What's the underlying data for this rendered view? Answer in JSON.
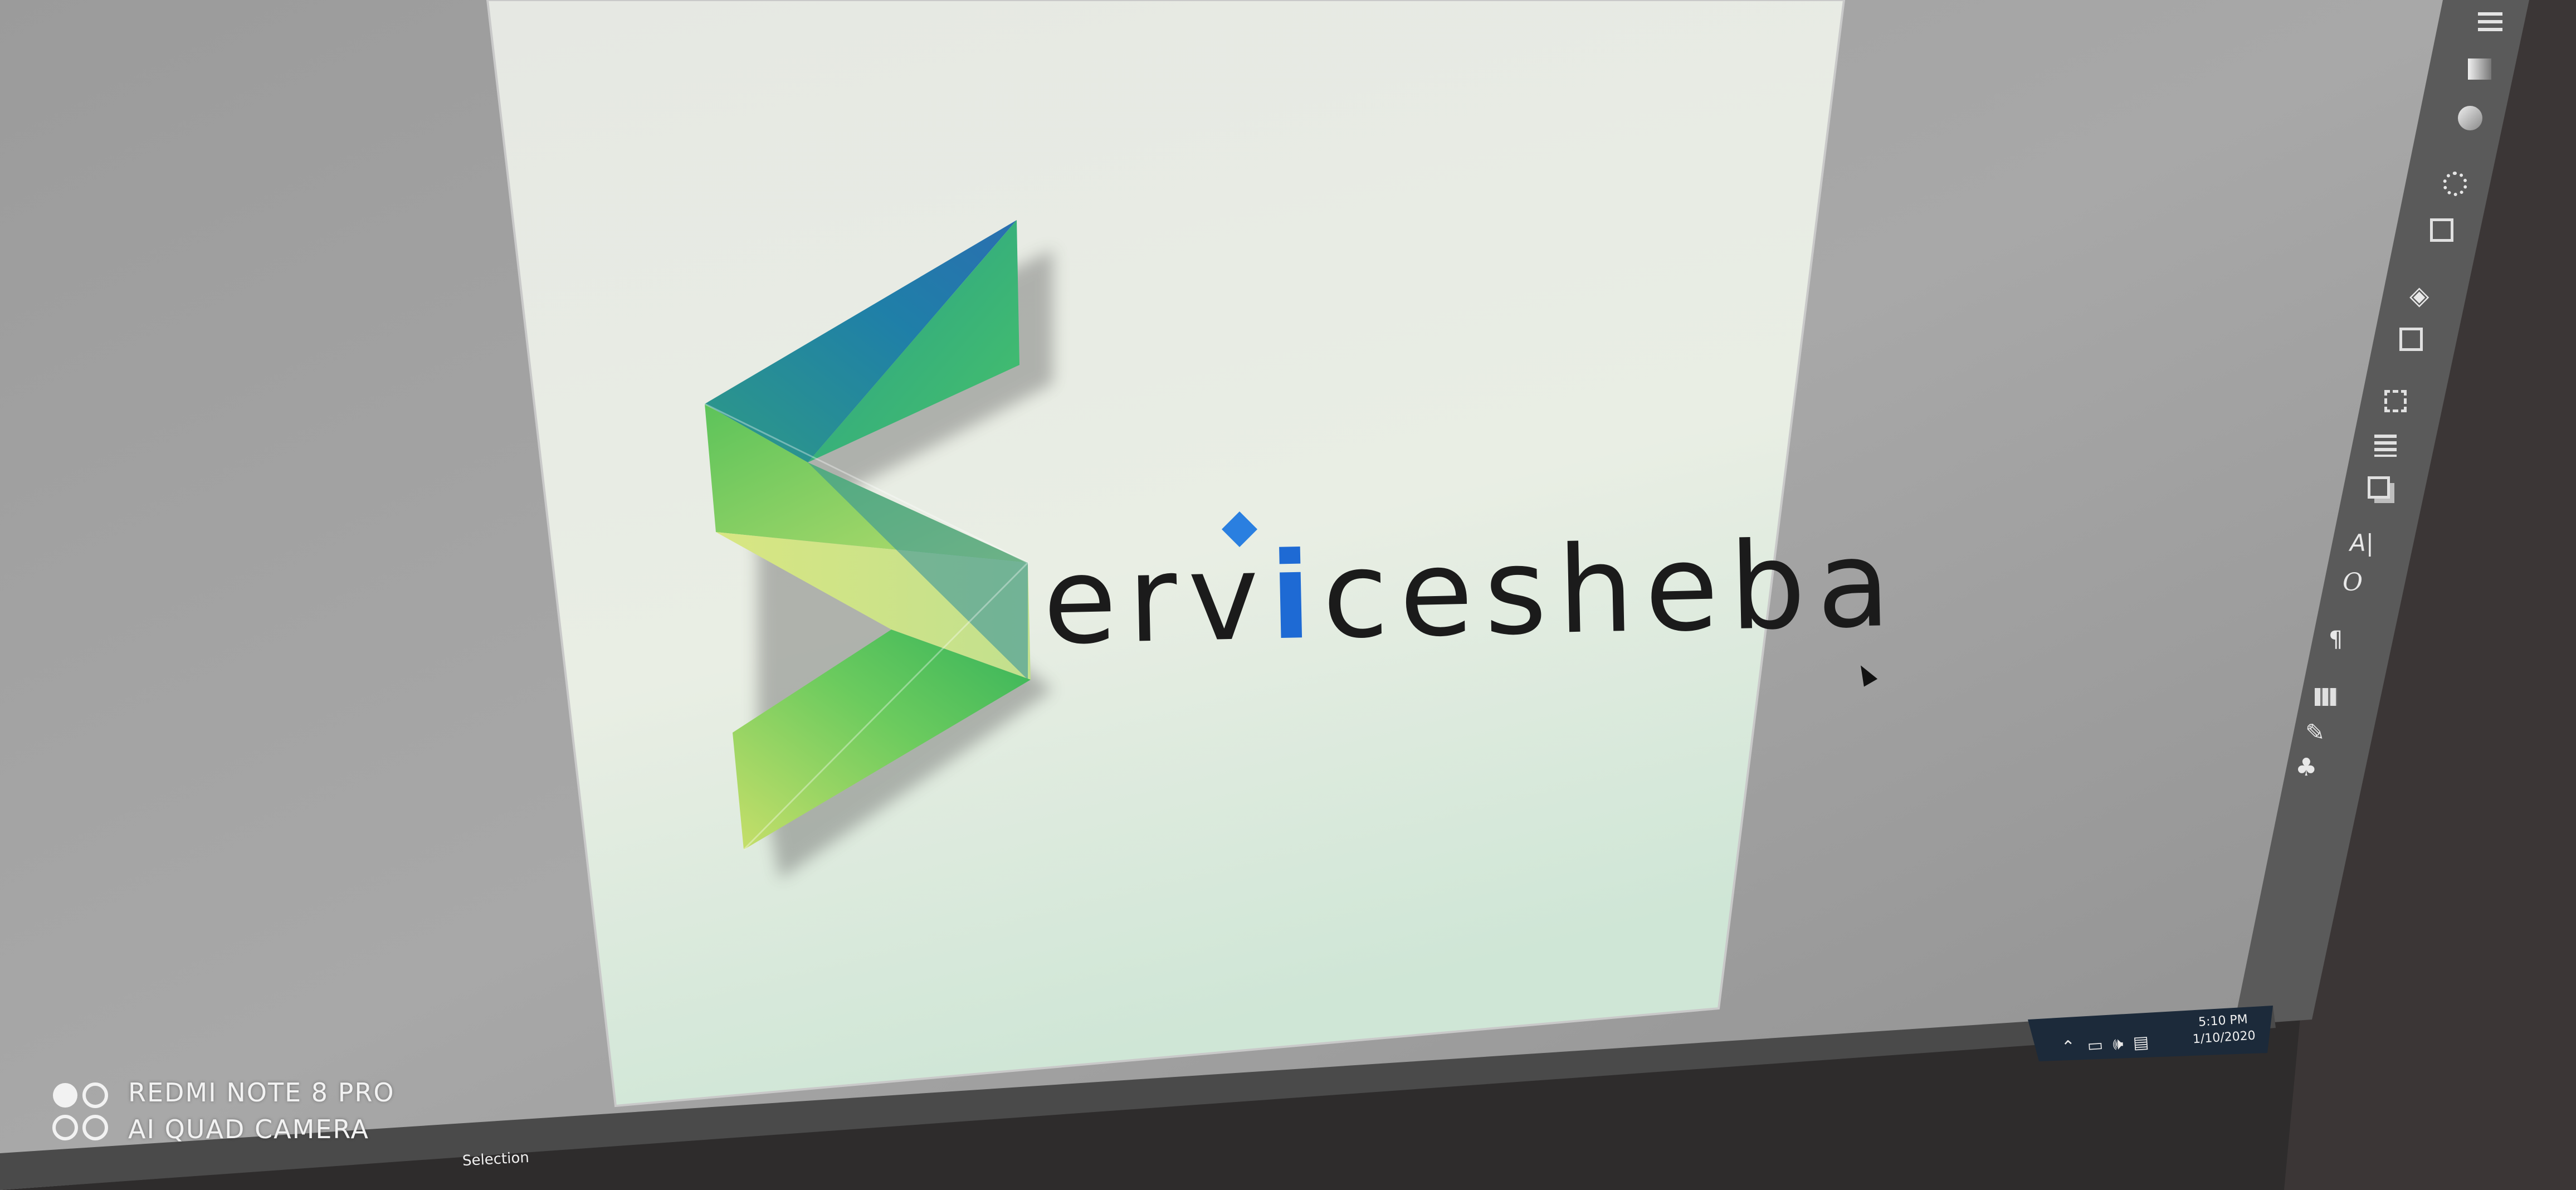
{
  "logo": {
    "wordmark_lead": "erv",
    "wordmark_i": "i",
    "wordmark_tail": "cesheba",
    "colors": {
      "teal": "#1f8a9e",
      "green": "#39b54a",
      "lime": "#c8e06a",
      "blue": "#1e73d8",
      "text": "#1b1b1b"
    }
  },
  "taskbar": {
    "time": "5:10 PM",
    "date": "1/10/2020"
  },
  "statusbar": {
    "tool_label": "Selection"
  },
  "watermark": {
    "line1": "REDMI NOTE 8 PRO",
    "line2": "AI QUAD CAMERA"
  },
  "panel_icons": [
    "menu-icon",
    "gradient-icon",
    "transparency-icon",
    "appearance-icon",
    "graphic-styles-icon",
    "layers-icon",
    "artboards-icon",
    "transform-icon",
    "align-icon",
    "pathfinder-icon",
    "character-icon",
    "opentype-icon",
    "paragraph-icon",
    "swatches-icon",
    "brushes-icon",
    "symbols-icon"
  ]
}
